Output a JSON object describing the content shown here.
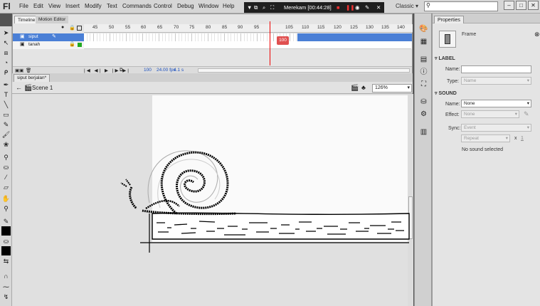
{
  "app": {
    "logo": "Fl"
  },
  "menu": [
    "File",
    "Edit",
    "View",
    "Insert",
    "Modify",
    "Text",
    "Commands",
    "Control",
    "Debug",
    "Window",
    "Help"
  ],
  "recorder": {
    "label": "Merekam [00:44:28]"
  },
  "workspace": "Classic",
  "search": {
    "placeholder": ""
  },
  "window_controls": [
    "–",
    "□",
    "✕"
  ],
  "timeline": {
    "tabs": [
      "Timeline",
      "Motion Editor"
    ],
    "frame_numbers": [
      "45",
      "50",
      "55",
      "60",
      "65",
      "70",
      "75",
      "80",
      "85",
      "90",
      "95",
      "100",
      "105",
      "110",
      "115",
      "120",
      "125",
      "130",
      "135",
      "140"
    ],
    "current_frame": "100",
    "layers": [
      {
        "name": "siput"
      },
      {
        "name": "tanah"
      }
    ],
    "footer": {
      "frame": "100",
      "fps": "24.00 fps",
      "time": "4.1 s"
    }
  },
  "document": {
    "tab": "siput berjalan*",
    "scene": "Scene 1",
    "zoom": "126%"
  },
  "properties": {
    "tab": "Properties",
    "type": "Frame",
    "label_section": "LABEL",
    "name_label": "Name:",
    "name_value": "",
    "type_label": "Type:",
    "type_value": "Name",
    "sound_section": "SOUND",
    "sound_name_label": "Name:",
    "sound_name_value": "None",
    "effect_label": "Effect:",
    "effect_value": "None",
    "sync_label": "Sync:",
    "sync_value": "Event",
    "repeat_value": "Repeat",
    "repeat_x": "x",
    "repeat_count": "1",
    "no_sound": "No sound selected"
  },
  "colors": {
    "playhead": "#e00000",
    "layer_selected": "#4a7fd6"
  }
}
